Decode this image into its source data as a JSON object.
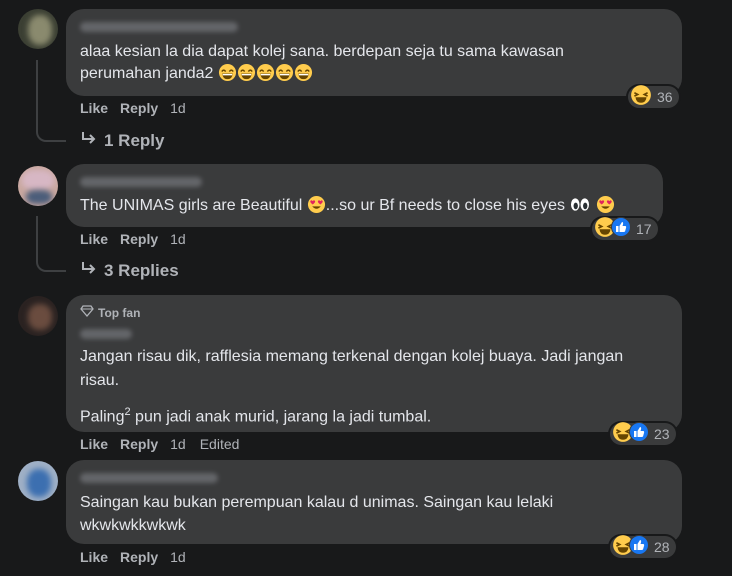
{
  "comments": [
    {
      "text_lines": [
        "alaa kesian la dia dapat kolej sana. berdepan seja tu sama kawasan",
        "perumahan janda2"
      ],
      "like": "Like",
      "reply": "Reply",
      "time": "1d",
      "reaction_count": "36",
      "replies_label": "1 Reply"
    },
    {
      "text_a": "The UNIMAS girls are Beautiful",
      "text_b": "...so ur Bf needs to close his eyes",
      "like": "Like",
      "reply": "Reply",
      "time": "1d",
      "reaction_count": "17",
      "replies_label": "3 Replies"
    },
    {
      "badge": "Top fan",
      "text_lines": [
        "Jangan risau dik, rafflesia memang terkenal dengan kolej buaya. Jadi jangan",
        "risau."
      ],
      "text_p2_a": "Paling",
      "text_p2_sup": "2",
      "text_p2_b": " pun jadi anak murid, jarang la jadi tumbal.",
      "like": "Like",
      "reply": "Reply",
      "time": "1d",
      "edited": "Edited",
      "reaction_count": "23"
    },
    {
      "text_lines": [
        "Saingan kau bukan perempuan kalau d unimas. Saingan kau lelaki",
        "wkwkwkkwkwk"
      ],
      "like": "Like",
      "reply": "Reply",
      "time": "1d",
      "reaction_count": "28"
    }
  ],
  "colors": {
    "background": "#18191a",
    "bubble": "#3a3b3c",
    "secondary_text": "#b0b3b8",
    "like_blue": "#1877f2",
    "emoji_yellow": "#ffcc4d"
  }
}
